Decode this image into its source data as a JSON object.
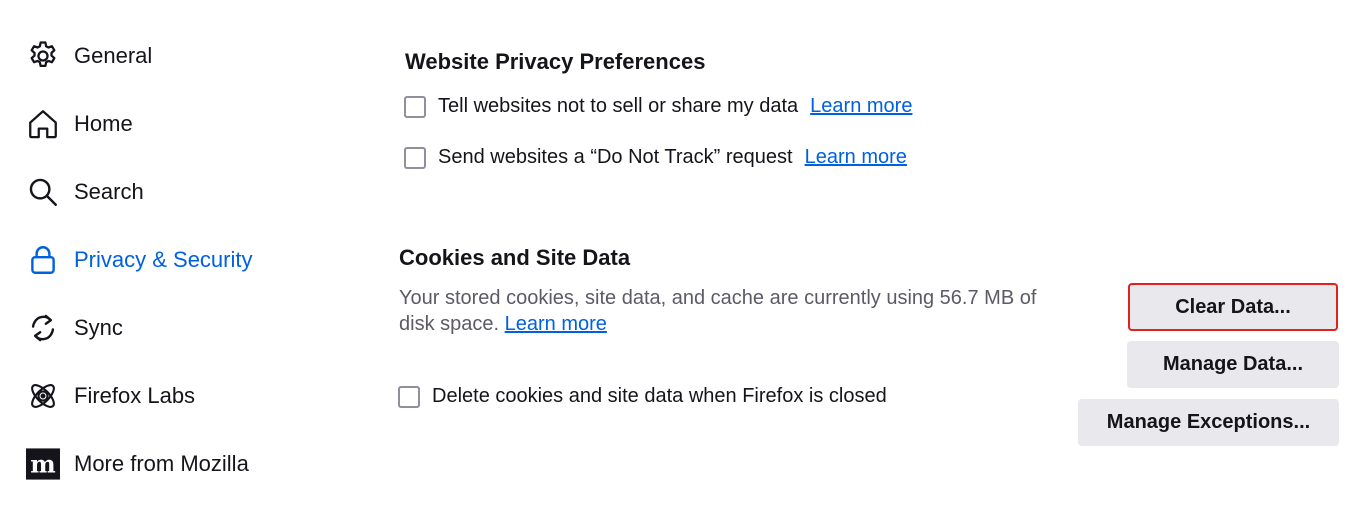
{
  "sidebar": {
    "items": [
      {
        "label": "General",
        "icon": "gear-icon"
      },
      {
        "label": "Home",
        "icon": "home-icon"
      },
      {
        "label": "Search",
        "icon": "search-icon"
      },
      {
        "label": "Privacy & Security",
        "icon": "lock-icon",
        "selected": true
      },
      {
        "label": "Sync",
        "icon": "sync-icon"
      },
      {
        "label": "Firefox Labs",
        "icon": "atom-icon"
      },
      {
        "label": "More from Mozilla",
        "icon": "mozilla-icon"
      }
    ]
  },
  "privacy_prefs": {
    "heading": "Website Privacy Preferences",
    "options": [
      {
        "label": "Tell websites not to sell or share my data",
        "link": "Learn more",
        "checked": false
      },
      {
        "label": "Send websites a “Do Not Track” request",
        "link": "Learn more",
        "checked": false
      }
    ]
  },
  "cookies": {
    "heading": "Cookies and Site Data",
    "description": "Your stored cookies, site data, and cache are currently using 56.7 MB of disk space.",
    "learn_more": "Learn more",
    "delete_option": {
      "label": "Delete cookies and site data when Firefox is closed",
      "checked": false
    },
    "buttons": {
      "clear": "Clear Data...",
      "manage": "Manage Data...",
      "exceptions": "Manage Exceptions..."
    }
  },
  "colors": {
    "accent": "#0061e0",
    "highlight": "#e0221e",
    "button_bg": "#e9e9ed"
  }
}
